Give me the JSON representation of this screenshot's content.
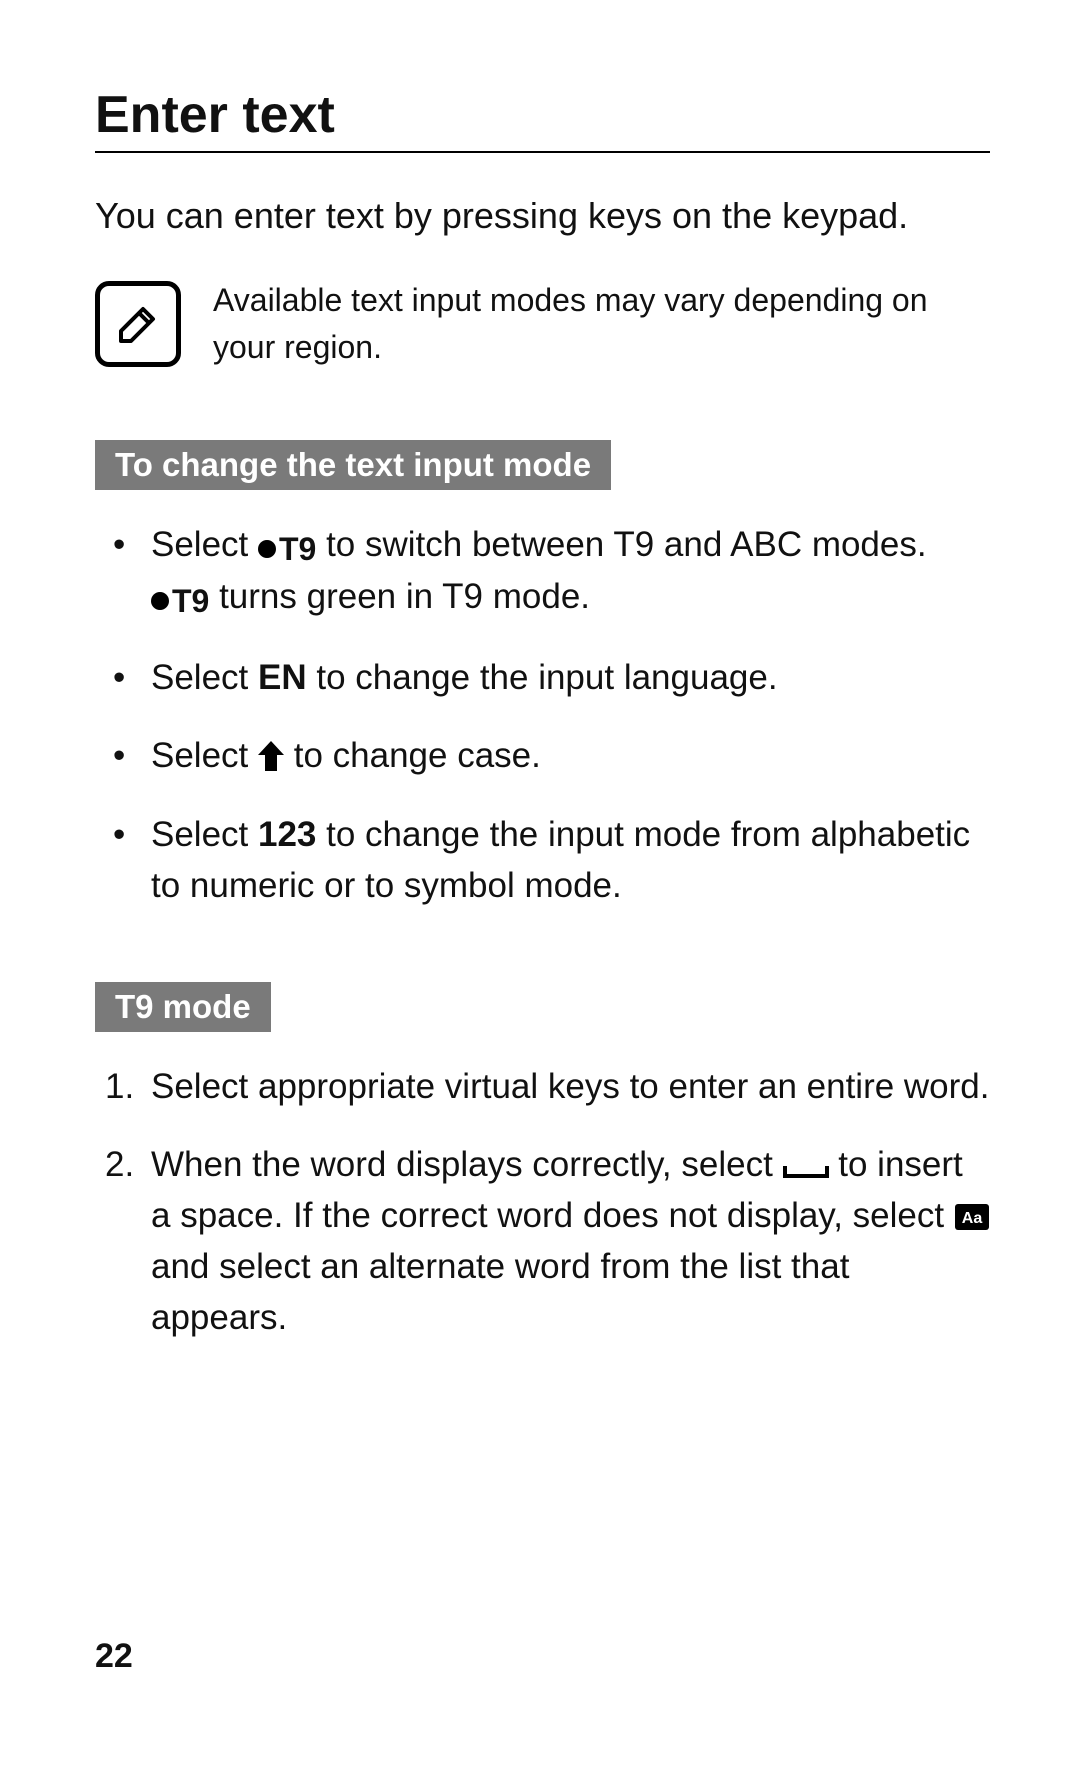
{
  "page": {
    "title": "Enter text",
    "intro": "You can enter text by pressing keys on the keypad.",
    "note": "Available text input modes may vary depending on your region.",
    "number": "22"
  },
  "icons": {
    "note": "pencil-note-icon",
    "t9_indicator": "T9",
    "shift": "shift-arrow-icon",
    "space": "space-bar-icon",
    "dictionary": "dictionary-aa-icon"
  },
  "section1": {
    "header": "To change the text input mode",
    "bullets": {
      "b1": {
        "p1": "Select ",
        "p2": " to switch between T9 and ABC modes. ",
        "p3": " turns green in T9 mode."
      },
      "b2": {
        "p1": "Select ",
        "en": "EN",
        "p2": " to change the input language."
      },
      "b3": {
        "p1": "Select ",
        "p2": " to change case."
      },
      "b4": {
        "p1": "Select ",
        "num": "123",
        "p2": " to change the input mode from alphabetic to numeric or to symbol mode."
      }
    }
  },
  "section2": {
    "header": "T9 mode",
    "steps": {
      "s1": "Select appropriate virtual keys to enter an entire word.",
      "s2": {
        "p1": "When the word displays correctly, select ",
        "p2": " to insert a space. If the correct word does not display, select ",
        "p3": " and select an alternate word from the list that appears."
      }
    }
  }
}
